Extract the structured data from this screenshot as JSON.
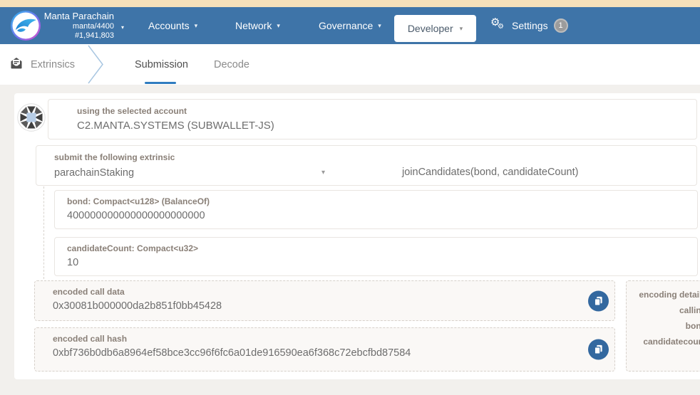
{
  "header": {
    "chain": {
      "name": "Manta Parachain",
      "endpoint": "manta/4400",
      "block": "#1,941,803"
    },
    "nav": {
      "accounts": "Accounts",
      "network": "Network",
      "governance": "Governance",
      "developer": "Developer",
      "settings": "Settings",
      "settings_badge": "1"
    }
  },
  "tabbar": {
    "section": "Extrinsics",
    "tabs": [
      {
        "label": "Submission"
      },
      {
        "label": "Decode"
      }
    ]
  },
  "form": {
    "account": {
      "label": "using the selected account",
      "value": "C2.MANTA.SYSTEMS (SUBWALLET-JS)"
    },
    "extrinsic": {
      "label": "submit the following extrinsic",
      "section": "parachainStaking",
      "method": "joinCandidates(bond, candidateCount)"
    },
    "params": [
      {
        "label": "bond: Compact<u128> (BalanceOf)",
        "value": "400000000000000000000000"
      },
      {
        "label": "candidateCount: Compact<u32>",
        "value": "10"
      }
    ],
    "outputs": [
      {
        "label": "encoded call data",
        "value": "0x30081b000000da2b851f0bb45428"
      },
      {
        "label": "encoded call hash",
        "value": "0xbf736b0db6a8964ef58bce3cc96f6fc6a01de916590ea6f368c72ebcfbd87584"
      }
    ],
    "encoding_details": {
      "title": "encoding details",
      "rows": [
        "calling",
        "bond",
        "candidatecount"
      ]
    }
  },
  "icons": {
    "caret_down": "▾",
    "gear": "⚙"
  },
  "colors": {
    "navbar_bg": "#3e74a8",
    "top_strip": "#f5e0ba",
    "tab_underline": "#2f7cc0",
    "copy_button": "#33689f",
    "badge_bg": "#9c9c9c",
    "label_text": "#8a8078"
  }
}
